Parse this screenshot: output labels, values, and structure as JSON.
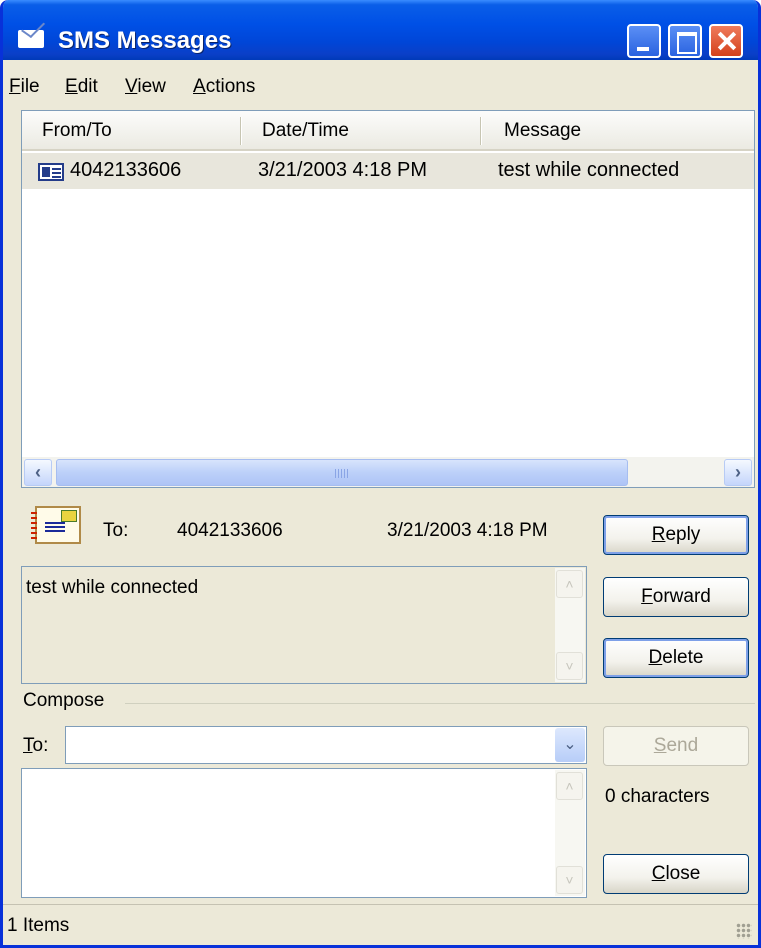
{
  "window": {
    "title": "SMS Messages"
  },
  "menu": {
    "file": "File",
    "edit": "Edit",
    "view": "View",
    "actions": "Actions"
  },
  "list": {
    "columns": [
      "From/To",
      "Date/Time",
      "Message"
    ],
    "rows": [
      {
        "from_to": "4042133606",
        "date_time": "3/21/2003 4:18 PM",
        "message": "test while connected"
      }
    ]
  },
  "detail": {
    "to_label": "To:",
    "to_number": "4042133606",
    "date_time": "3/21/2003 4:18 PM",
    "body": "test while connected"
  },
  "buttons": {
    "reply": "Reply",
    "forward": "Forward",
    "delete": "Delete",
    "send": "Send",
    "close": "Close"
  },
  "compose": {
    "section_label": "Compose",
    "to_label": "To:",
    "to_value": "",
    "body": "",
    "char_count": "0 characters"
  },
  "status": {
    "items": "1 Items"
  },
  "colors": {
    "titlebar": "#0050e6",
    "window_bg": "#ece9d8",
    "selected_row": "#e8e6dc",
    "close_button": "#d4421c"
  }
}
